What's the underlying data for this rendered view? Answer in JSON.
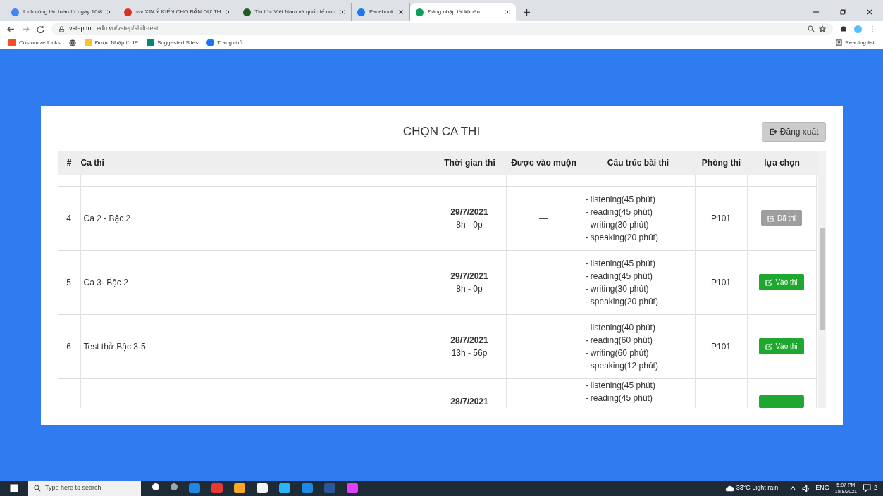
{
  "browser": {
    "tabs": [
      {
        "title": "Lịch công tác tuần từ ngày 16/8",
        "selected": false
      },
      {
        "title": "v/v XIN Ý KIẾN CHO BẢN DỰ TH",
        "selected": false
      },
      {
        "title": "Tin tức Việt Nam và quốc tế nón",
        "selected": false
      },
      {
        "title": "Facebook",
        "selected": false
      },
      {
        "title": "Đăng nhập tài khoản",
        "selected": true
      }
    ],
    "url_host": "vstep.tnu.edu.vn",
    "url_path": "/vstep/shift-test",
    "bookmarks": [
      "Customize Links",
      "Được Nhập từ IE",
      "Suggested Sites",
      "Trang chủ"
    ],
    "reading_list": "Reading list"
  },
  "page": {
    "title": "CHỌN CA THI",
    "logout": "Đăng xuất",
    "table": {
      "columns": [
        "#",
        "Ca thi",
        "Thời gian thi",
        "Được vào muộn",
        "Cấu trúc bài thi",
        "Phòng thi",
        "lựa chọn"
      ],
      "rows": [
        {
          "num": "4",
          "name": "Ca 2 - Bậc 2",
          "date": "29/7/2021",
          "time": "8h - 0p",
          "late": "—",
          "structure": [
            "- listening(45 phút)",
            "- reading(45 phút)",
            "- writing(30 phút)",
            "- speaking(20 phút)"
          ],
          "room": "P101",
          "action": {
            "label": "Đã thi",
            "kind": "done"
          }
        },
        {
          "num": "5",
          "name": "Ca 3- Bậc 2",
          "date": "29/7/2021",
          "time": "8h - 0p",
          "late": "—",
          "structure": [
            "- listening(45 phút)",
            "- reading(45 phút)",
            "- writing(30 phút)",
            "- speaking(20 phút)"
          ],
          "room": "P101",
          "action": {
            "label": "Vào thi",
            "kind": "enter"
          }
        },
        {
          "num": "6",
          "name": "Test thử Bậc 3-5",
          "date": "28/7/2021",
          "time": "13h - 56p",
          "late": "—",
          "structure": [
            "- listening(40 phút)",
            "- reading(60 phút)",
            "- writing(60 phút)",
            "- speaking(12 phút)"
          ],
          "room": "P101",
          "action": {
            "label": "Vào thi",
            "kind": "enter"
          }
        },
        {
          "date": "28/7/2021",
          "structure": [
            "- listening(45 phút)",
            "- reading(45 phút)"
          ],
          "action": {
            "kind": "enter"
          }
        }
      ]
    }
  },
  "taskbar": {
    "search_placeholder": "Type here to search",
    "weather": "33°C  Light rain",
    "language": "ENG",
    "time": "5:07 PM",
    "date": "19/8/2021",
    "notifications": "2"
  }
}
